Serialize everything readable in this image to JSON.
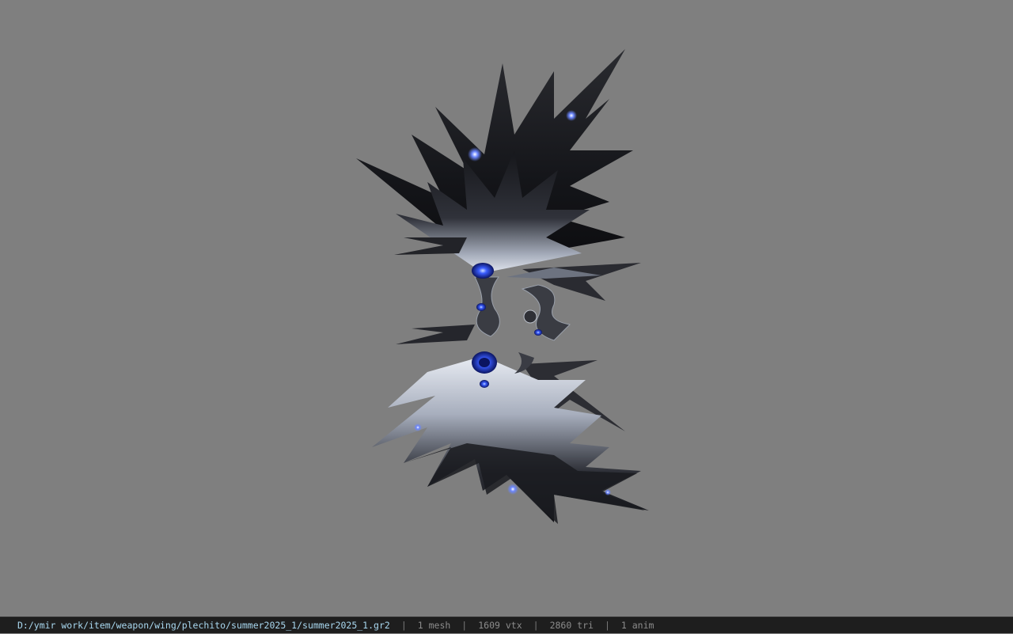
{
  "viewport": {
    "background_color": "#7f7f7f",
    "model_subject": "wing model with dark feathers and blue gem accents"
  },
  "status_bar": {
    "file_path": "D:/ymir work/item/weapon/wing/plechito/summer2025_1/summer2025_1.gr2",
    "separator": "|",
    "mesh_count": "1 mesh",
    "vertex_count": "1609 vtx",
    "triangle_count": "2860 tri",
    "anim_count": "1 anim"
  },
  "colors": {
    "feather_dark": "#1a1b1f",
    "feather_light": "#d6dbe4",
    "gem_blue": "#2b4cff",
    "status_bg": "#1e1e1e",
    "path_text": "#a9d8f0"
  }
}
